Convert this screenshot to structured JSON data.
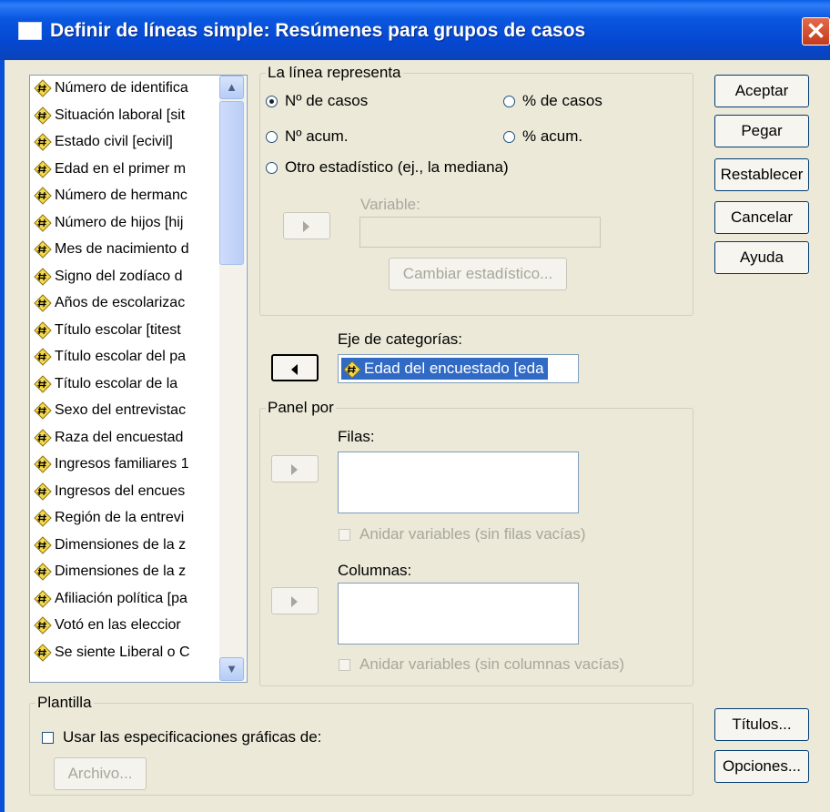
{
  "window": {
    "title": "Definir de líneas simple: Resúmenes para grupos de casos"
  },
  "variables": [
    "Número de identifica",
    "Situación laboral [sit",
    "Estado civil [ecivil]",
    "Edad en el primer m",
    "Número de hermanc",
    "Número de hijos [hij",
    "Mes de nacimiento d",
    "Signo del zodíaco d",
    "Años de escolarizac",
    "Título escolar [titest",
    "Título escolar del pa",
    "Título escolar de la",
    "Sexo del entrevistac",
    "Raza del encuestad",
    "Ingresos familiares 1",
    "Ingresos del encues",
    "Región de la entrevi",
    "Dimensiones de la z",
    "Dimensiones de la z",
    "Afiliación política [pa",
    "Votó en las eleccior",
    "Se siente Liberal o C"
  ],
  "line_represents": {
    "legend": "La línea representa",
    "options": [
      {
        "label": "Nº de casos",
        "selected": true
      },
      {
        "label": "% de casos",
        "selected": false
      },
      {
        "label": "Nº acum.",
        "selected": false
      },
      {
        "label": "% acum.",
        "selected": false
      },
      {
        "label": "Otro estadístico (ej., la mediana)",
        "selected": false
      }
    ],
    "variable_label": "Variable:",
    "change_stat_label": "Cambiar estadístico..."
  },
  "category_axis": {
    "label": "Eje de categorías:",
    "value": "Edad del encuestado [eda"
  },
  "panel": {
    "legend": "Panel por",
    "rows_label": "Filas:",
    "nest_rows_label": "Anidar variables (sin filas vacías)",
    "columns_label": "Columnas:",
    "nest_columns_label": "Anidar variables (sin columnas vacías)"
  },
  "template": {
    "legend": "Plantilla",
    "use_specs_label": "Usar las especificaciones gráficas de:",
    "file_label": "Archivo..."
  },
  "buttons": {
    "ok": "Aceptar",
    "paste": "Pegar",
    "reset": "Restablecer",
    "cancel": "Cancelar",
    "help": "Ayuda",
    "titles": "Títulos...",
    "options": "Opciones..."
  },
  "close_glyph": "✕"
}
